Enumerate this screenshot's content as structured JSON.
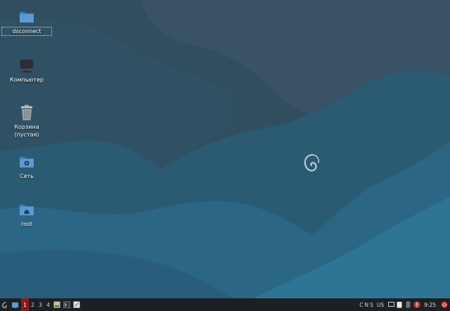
{
  "colors": {
    "accent": "#8b1a1a",
    "folder": "#5b9bd5",
    "taskbar": "#1c1f24"
  },
  "desktop": {
    "icons": [
      {
        "label": "dsconnect",
        "icon": "folder-icon",
        "selected": true
      },
      {
        "label": "Компьютер",
        "icon": "computer-icon"
      },
      {
        "label": "Корзина\n(пустая)",
        "icon": "trash-icon"
      },
      {
        "label": "Сеть",
        "icon": "network-folder-icon"
      },
      {
        "label": "root",
        "icon": "home-folder-icon"
      }
    ],
    "wallpaper_logo": "debian-swirl-logo"
  },
  "taskbar": {
    "launchers": [
      "start-menu-icon",
      "file-manager-icon"
    ],
    "workspaces": [
      "1",
      "2",
      "3",
      "4"
    ],
    "active_workspace": "1",
    "tasks": [
      "disk-app-icon",
      "terminal-icon",
      "text-editor-icon"
    ],
    "indicators": {
      "caps": "C",
      "num": "N",
      "scroll": "S"
    },
    "keyboard_layout": "US",
    "tray": [
      "display-icon",
      "clipboard-icon",
      "battery-icon",
      "alert-icon"
    ],
    "clock": "9:25",
    "power": "power-icon"
  }
}
